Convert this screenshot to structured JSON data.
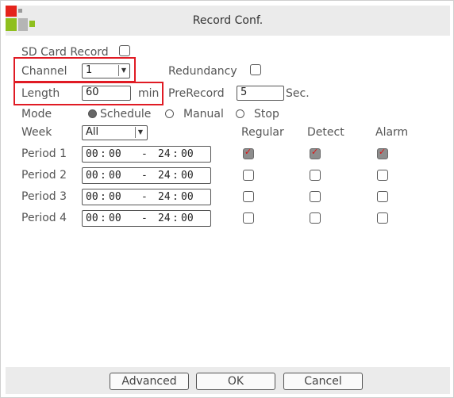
{
  "window": {
    "title": "Record Conf."
  },
  "colors": {
    "highlight": "#e01b24",
    "checked_fill": "#8d8d8d",
    "check_mark": "#dd1111"
  },
  "sd_card": {
    "label": "SD Card Record",
    "checked": false
  },
  "channel": {
    "label": "Channel",
    "value": "1"
  },
  "redundancy": {
    "label": "Redundancy",
    "checked": false
  },
  "length": {
    "label": "Length",
    "value": "60",
    "unit": "min"
  },
  "prerecord": {
    "label": "PreRecord",
    "value": "5",
    "unit": "Sec."
  },
  "mode": {
    "label": "Mode",
    "options": [
      "Schedule",
      "Manual",
      "Stop"
    ],
    "selected": "Schedule"
  },
  "week": {
    "label": "Week",
    "value": "All"
  },
  "columns": [
    "Regular",
    "Detect",
    "Alarm"
  ],
  "periods": [
    {
      "label": "Period 1",
      "start_h": "00",
      "start_m": "00",
      "sep": "-",
      "end_h": "24",
      "end_m": "00",
      "regular": true,
      "detect": true,
      "alarm": true
    },
    {
      "label": "Period 2",
      "start_h": "00",
      "start_m": "00",
      "sep": "-",
      "end_h": "24",
      "end_m": "00",
      "regular": false,
      "detect": false,
      "alarm": false
    },
    {
      "label": "Period 3",
      "start_h": "00",
      "start_m": "00",
      "sep": "-",
      "end_h": "24",
      "end_m": "00",
      "regular": false,
      "detect": false,
      "alarm": false
    },
    {
      "label": "Period 4",
      "start_h": "00",
      "start_m": "00",
      "sep": "-",
      "end_h": "24",
      "end_m": "00",
      "regular": false,
      "detect": false,
      "alarm": false
    }
  ],
  "buttons": {
    "advanced": "Advanced",
    "ok": "OK",
    "cancel": "Cancel"
  }
}
